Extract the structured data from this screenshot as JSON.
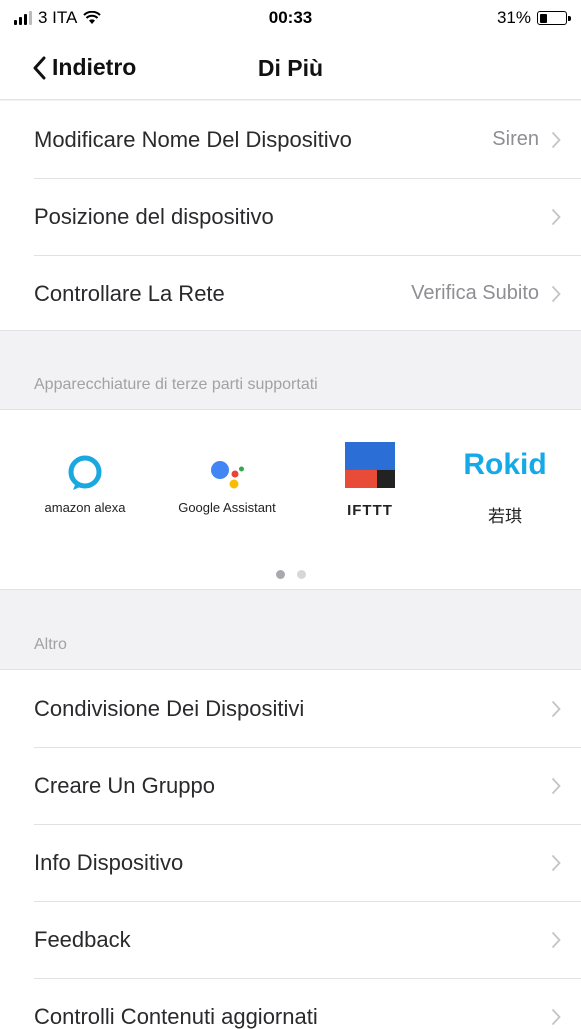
{
  "status_bar": {
    "carrier": "3 ITA",
    "time": "00:33",
    "battery_percent_label": "31%",
    "battery_level": 0.31
  },
  "nav": {
    "back_label": "Indietro",
    "title": "Di Più"
  },
  "settings_top": [
    {
      "label": "Modificare Nome Del Dispositivo",
      "value": "Siren"
    },
    {
      "label": "Posizione del dispositivo",
      "value": ""
    },
    {
      "label": "Controllare La Rete",
      "value": "Verifica Subito"
    }
  ],
  "third_party": {
    "header": "Apparecchiature di terze parti supportati",
    "partners": [
      {
        "name": "amazon alexa",
        "icon": "alexa-icon"
      },
      {
        "name": "Google Assistant",
        "icon": "google-assistant-icon"
      },
      {
        "name": "IFTTT",
        "icon": "ifttt-icon"
      },
      {
        "name": "Rokid",
        "caption": "若琪",
        "icon": "rokid-icon"
      }
    ],
    "pager": {
      "pages": 2,
      "current": 1
    }
  },
  "other": {
    "header": "Altro",
    "items": [
      {
        "label": "Condivisione Dei Dispositivi"
      },
      {
        "label": "Creare Un Gruppo"
      },
      {
        "label": "Info Dispositivo"
      },
      {
        "label": "Feedback"
      },
      {
        "label": "Controlli Contenuti aggiornati"
      }
    ]
  },
  "colors": {
    "alexa": "#1aa8e0",
    "google_blue": "#4285f4",
    "google_red": "#ea4335",
    "google_yellow": "#fbbc05",
    "google_green": "#34a853",
    "ifttt_blue": "#2b6ed6",
    "ifttt_red": "#e84b37",
    "ifttt_dark": "#222222",
    "rokid": "#15a9e8"
  }
}
